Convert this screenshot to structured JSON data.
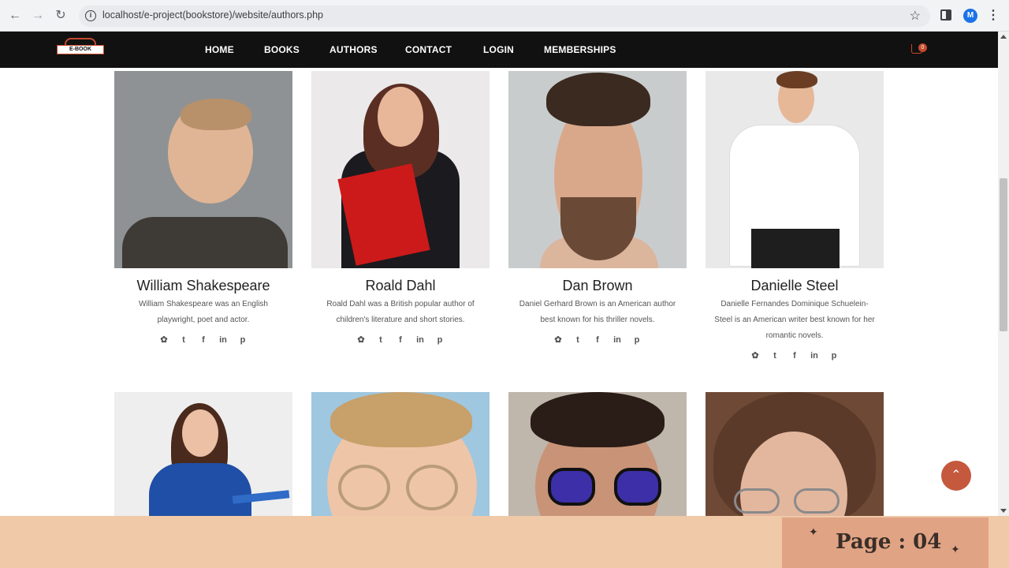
{
  "browser": {
    "url": "localhost/e-project(bookstore)/website/authors.php",
    "avatar_letter": "M"
  },
  "nav": {
    "logo_text": "E-BOOK",
    "links": [
      "HOME",
      "BOOKS",
      "AUTHORS",
      "CONTACT",
      "LOGIN",
      "MEMBERSHIPS"
    ],
    "cart_count": "0"
  },
  "authors": [
    {
      "name": "William Shakespeare",
      "bio": "William Shakespeare was an English playwright, poet and actor."
    },
    {
      "name": "Roald Dahl",
      "bio": "Roald Dahl was a British popular author of children's literature and short stories."
    },
    {
      "name": "Dan Brown",
      "bio": "Daniel Gerhard Brown is an American author best known for his thriller novels."
    },
    {
      "name": "Danielle Steel",
      "bio": "Danielle Fernandes Dominique Schuelein-Steel is an American writer best known for her romantic novels."
    }
  ],
  "social_icons": [
    "twitter-icon",
    "tumblr-icon",
    "facebook-icon",
    "linkedin-icon",
    "pinterest-icon"
  ],
  "footer": {
    "page_label": "Page :  04"
  },
  "colors": {
    "accent": "#c4593d",
    "nav_bg": "#111111",
    "footer_bg": "#efc9a8"
  }
}
